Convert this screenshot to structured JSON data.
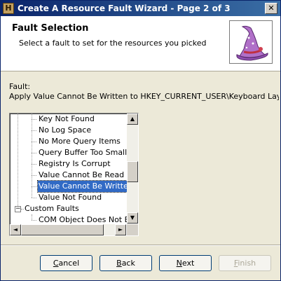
{
  "window": {
    "title": "Create A Resource Fault Wizard - Page 2 of 3",
    "app_icon_glyph": "H",
    "close_glyph": "✕"
  },
  "header": {
    "title": "Fault Selection",
    "subtitle": "Select a fault to set for the resources you picked",
    "icon": "wizard-hat-icon"
  },
  "fault": {
    "label": "Fault:",
    "description": "Apply Value Cannot Be Written to HKEY_CURRENT_USER\\Keyboard Layou"
  },
  "tree": {
    "items": [
      "Key Not Found",
      "No Log Space",
      "No More Query Items",
      "Query Buffer Too Small",
      "Registry Is Corrupt",
      "Value Cannot Be Read",
      "Value Cannot Be Written",
      "Value Not Found"
    ],
    "selected": "Value Cannot Be Written",
    "group_label": "Custom Faults",
    "group_expander": "−",
    "group_child": "COM Object Does Not Exis",
    "scroll_up": "▲",
    "scroll_down": "▼",
    "scroll_left": "◄",
    "scroll_right": "►"
  },
  "buttons": {
    "cancel": {
      "label": "Cancel",
      "mnemonic": "C",
      "rest": "ancel"
    },
    "back": {
      "label": "Back",
      "mnemonic": "B",
      "rest": "ack"
    },
    "next": {
      "label": "Next",
      "mnemonic": "N",
      "rest": "ext"
    },
    "finish": {
      "label": "Finish",
      "mnemonic": "F",
      "rest": "inish"
    }
  }
}
